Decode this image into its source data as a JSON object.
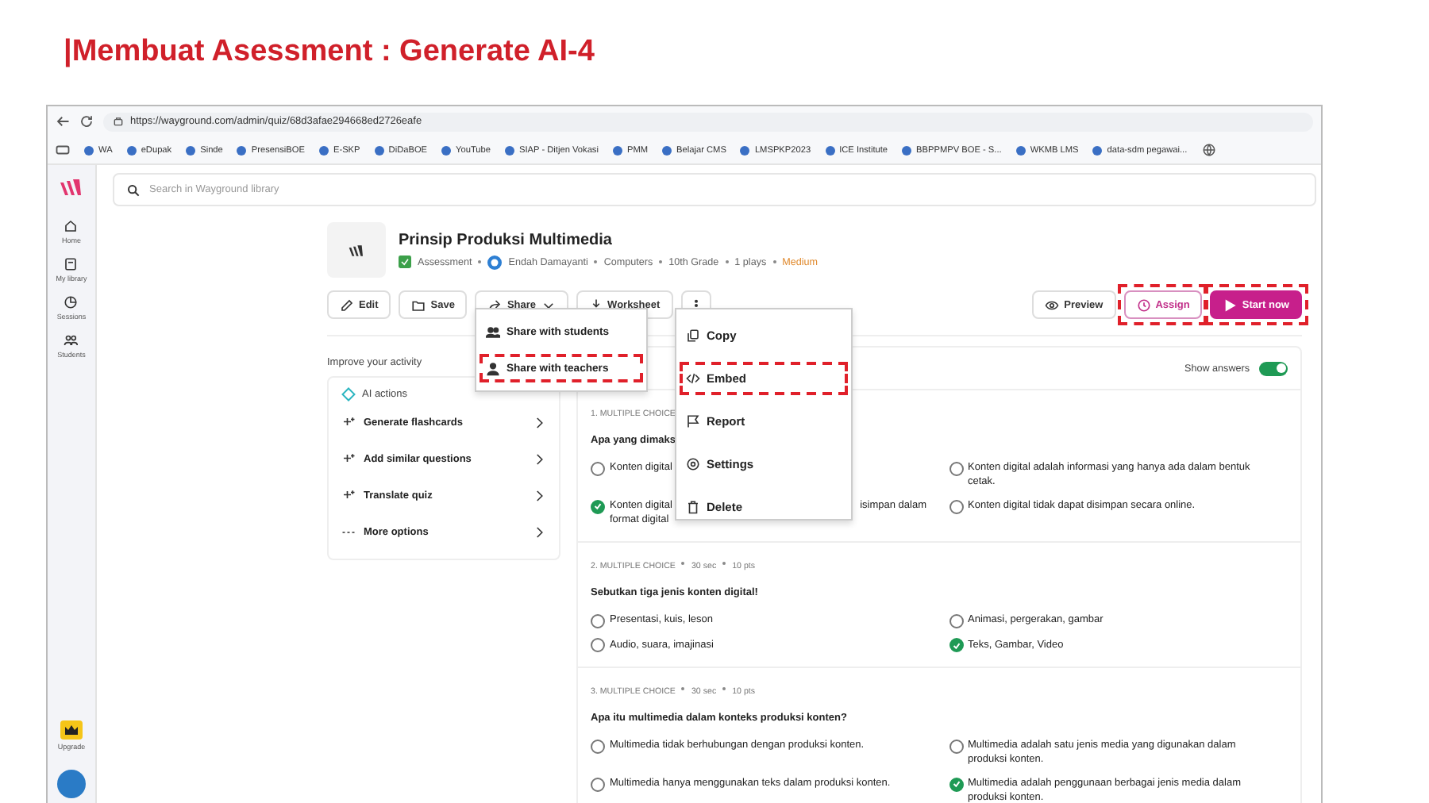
{
  "slide_title": "|Membuat Asessment : Generate AI-4",
  "browser": {
    "url": "https://wayground.com/admin/quiz/68d3afae294668ed2726eafe",
    "bookmarks": [
      "WA",
      "eDupak",
      "Sinde",
      "PresensiBOE",
      "E-SKP",
      "DiDaBOE",
      "YouTube",
      "SIAP - Ditjen Vokasi",
      "PMM",
      "Belajar CMS",
      "LMSPKP2023",
      "ICE Institute",
      "BBPPMPV BOE - S...",
      "WKMB LMS",
      "data-sdm pegawai..."
    ]
  },
  "app": {
    "search_placeholder": "Search in Wayground library",
    "nav": [
      {
        "label": "Home",
        "kind": "home"
      },
      {
        "label": "My library",
        "kind": "library"
      },
      {
        "label": "Sessions",
        "kind": "sessions"
      },
      {
        "label": "Students",
        "kind": "students"
      }
    ],
    "upgrade": "Upgrade"
  },
  "quiz": {
    "title": "Prinsip Produksi Multimedia",
    "meta": [
      {
        "text": "Assessment",
        "kind": "type"
      },
      {
        "text": "Endah Damayanti",
        "kind": "author"
      },
      {
        "text": "Computers",
        "kind": "text"
      },
      {
        "text": "10th Grade",
        "kind": "text"
      },
      {
        "text": "1 plays",
        "kind": "text"
      },
      {
        "text": "Medium",
        "kind": "difficulty"
      }
    ],
    "toolbar": [
      {
        "label": "Edit",
        "kind": "edit"
      },
      {
        "label": "Save",
        "kind": "save"
      },
      {
        "label": "Share",
        "kind": "share"
      },
      {
        "label": "Worksheet",
        "kind": "worksheet"
      },
      {
        "kind": "more"
      }
    ],
    "actions": [
      {
        "label": "Preview",
        "kind": "preview",
        "highlighted": false
      },
      {
        "label": "Assign",
        "kind": "assign",
        "highlighted": true
      },
      {
        "label": "Start now",
        "kind": "start",
        "highlighted": true
      }
    ],
    "share_menu": [
      {
        "label": "Share with students",
        "kind": "students",
        "highlighted": false
      },
      {
        "label": "Share with teachers",
        "kind": "teacher",
        "highlighted": true
      }
    ],
    "more_menu": [
      {
        "label": "Copy",
        "kind": "copy",
        "highlighted": false
      },
      {
        "label": "Embed",
        "kind": "embed",
        "highlighted": true
      },
      {
        "label": "Report",
        "kind": "report",
        "highlighted": false
      },
      {
        "label": "Settings",
        "kind": "settings",
        "highlighted": false
      },
      {
        "label": "Delete",
        "kind": "delete",
        "highlighted": false
      }
    ],
    "improve": {
      "title": "Improve your activity",
      "ai_label": "AI actions",
      "items": [
        "Generate flashcards",
        "Add similar questions",
        "Translate quiz",
        "More options"
      ]
    },
    "show_answers": {
      "label": "Show answers",
      "on": true
    },
    "questions": [
      {
        "meta": [
          "1. MULTIPLE CHOICE"
        ],
        "question": "Apa yang dimaks",
        "options": [
          {
            "text": "Konten digital",
            "correct": false
          },
          {
            "text": "Konten digital adalah informasi yang hanya ada dalam bentuk cetak.",
            "correct": false
          },
          {
            "text": "Konten digital",
            "tail": "isimpan dalam",
            "line2": "format digital",
            "correct": true
          },
          {
            "text": "Konten digital tidak dapat disimpan secara online.",
            "correct": false
          }
        ]
      },
      {
        "meta": [
          "2. MULTIPLE CHOICE",
          "30 sec",
          "10 pts"
        ],
        "question": "Sebutkan tiga jenis konten digital!",
        "options": [
          {
            "text": "Presentasi, kuis, leson",
            "correct": false
          },
          {
            "text": "Animasi, pergerakan, gambar",
            "correct": false
          },
          {
            "text": "Audio, suara, imajinasi",
            "correct": false
          },
          {
            "text": "Teks, Gambar, Video",
            "correct": true
          }
        ]
      },
      {
        "meta": [
          "3. MULTIPLE CHOICE",
          "30 sec",
          "10 pts"
        ],
        "question": "Apa itu multimedia dalam konteks produksi konten?",
        "options": [
          {
            "text": "Multimedia tidak berhubungan dengan produksi konten.",
            "correct": false
          },
          {
            "text": "Multimedia adalah satu jenis media yang digunakan dalam produksi konten.",
            "correct": false
          },
          {
            "text": "Multimedia hanya menggunakan teks dalam produksi konten.",
            "correct": false
          },
          {
            "text": "Multimedia adalah penggunaan berbagai jenis media dalam produksi konten.",
            "correct": true
          }
        ]
      }
    ]
  }
}
